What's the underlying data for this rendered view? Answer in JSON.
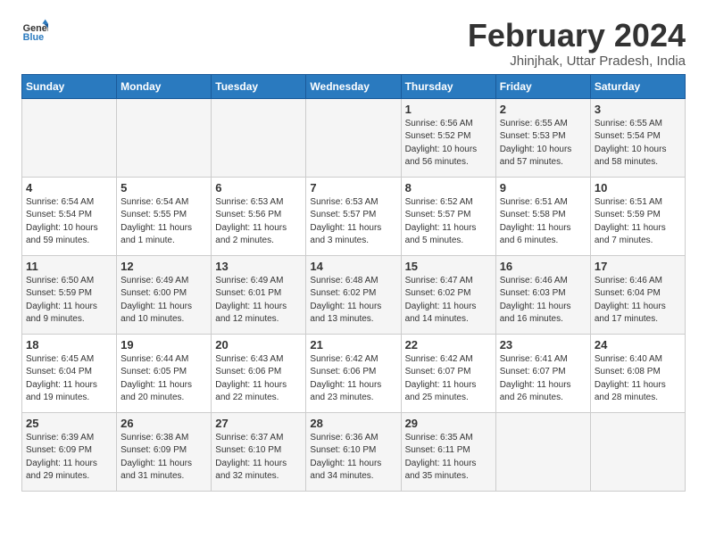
{
  "logo": {
    "line1": "General",
    "line2": "Blue"
  },
  "title": "February 2024",
  "subtitle": "Jhinjhak, Uttar Pradesh, India",
  "header_days": [
    "Sunday",
    "Monday",
    "Tuesday",
    "Wednesday",
    "Thursday",
    "Friday",
    "Saturday"
  ],
  "weeks": [
    [
      {
        "day": "",
        "info": ""
      },
      {
        "day": "",
        "info": ""
      },
      {
        "day": "",
        "info": ""
      },
      {
        "day": "",
        "info": ""
      },
      {
        "day": "1",
        "info": "Sunrise: 6:56 AM\nSunset: 5:52 PM\nDaylight: 10 hours and 56 minutes."
      },
      {
        "day": "2",
        "info": "Sunrise: 6:55 AM\nSunset: 5:53 PM\nDaylight: 10 hours and 57 minutes."
      },
      {
        "day": "3",
        "info": "Sunrise: 6:55 AM\nSunset: 5:54 PM\nDaylight: 10 hours and 58 minutes."
      }
    ],
    [
      {
        "day": "4",
        "info": "Sunrise: 6:54 AM\nSunset: 5:54 PM\nDaylight: 10 hours and 59 minutes."
      },
      {
        "day": "5",
        "info": "Sunrise: 6:54 AM\nSunset: 5:55 PM\nDaylight: 11 hours and 1 minute."
      },
      {
        "day": "6",
        "info": "Sunrise: 6:53 AM\nSunset: 5:56 PM\nDaylight: 11 hours and 2 minutes."
      },
      {
        "day": "7",
        "info": "Sunrise: 6:53 AM\nSunset: 5:57 PM\nDaylight: 11 hours and 3 minutes."
      },
      {
        "day": "8",
        "info": "Sunrise: 6:52 AM\nSunset: 5:57 PM\nDaylight: 11 hours and 5 minutes."
      },
      {
        "day": "9",
        "info": "Sunrise: 6:51 AM\nSunset: 5:58 PM\nDaylight: 11 hours and 6 minutes."
      },
      {
        "day": "10",
        "info": "Sunrise: 6:51 AM\nSunset: 5:59 PM\nDaylight: 11 hours and 7 minutes."
      }
    ],
    [
      {
        "day": "11",
        "info": "Sunrise: 6:50 AM\nSunset: 5:59 PM\nDaylight: 11 hours and 9 minutes."
      },
      {
        "day": "12",
        "info": "Sunrise: 6:49 AM\nSunset: 6:00 PM\nDaylight: 11 hours and 10 minutes."
      },
      {
        "day": "13",
        "info": "Sunrise: 6:49 AM\nSunset: 6:01 PM\nDaylight: 11 hours and 12 minutes."
      },
      {
        "day": "14",
        "info": "Sunrise: 6:48 AM\nSunset: 6:02 PM\nDaylight: 11 hours and 13 minutes."
      },
      {
        "day": "15",
        "info": "Sunrise: 6:47 AM\nSunset: 6:02 PM\nDaylight: 11 hours and 14 minutes."
      },
      {
        "day": "16",
        "info": "Sunrise: 6:46 AM\nSunset: 6:03 PM\nDaylight: 11 hours and 16 minutes."
      },
      {
        "day": "17",
        "info": "Sunrise: 6:46 AM\nSunset: 6:04 PM\nDaylight: 11 hours and 17 minutes."
      }
    ],
    [
      {
        "day": "18",
        "info": "Sunrise: 6:45 AM\nSunset: 6:04 PM\nDaylight: 11 hours and 19 minutes."
      },
      {
        "day": "19",
        "info": "Sunrise: 6:44 AM\nSunset: 6:05 PM\nDaylight: 11 hours and 20 minutes."
      },
      {
        "day": "20",
        "info": "Sunrise: 6:43 AM\nSunset: 6:06 PM\nDaylight: 11 hours and 22 minutes."
      },
      {
        "day": "21",
        "info": "Sunrise: 6:42 AM\nSunset: 6:06 PM\nDaylight: 11 hours and 23 minutes."
      },
      {
        "day": "22",
        "info": "Sunrise: 6:42 AM\nSunset: 6:07 PM\nDaylight: 11 hours and 25 minutes."
      },
      {
        "day": "23",
        "info": "Sunrise: 6:41 AM\nSunset: 6:07 PM\nDaylight: 11 hours and 26 minutes."
      },
      {
        "day": "24",
        "info": "Sunrise: 6:40 AM\nSunset: 6:08 PM\nDaylight: 11 hours and 28 minutes."
      }
    ],
    [
      {
        "day": "25",
        "info": "Sunrise: 6:39 AM\nSunset: 6:09 PM\nDaylight: 11 hours and 29 minutes."
      },
      {
        "day": "26",
        "info": "Sunrise: 6:38 AM\nSunset: 6:09 PM\nDaylight: 11 hours and 31 minutes."
      },
      {
        "day": "27",
        "info": "Sunrise: 6:37 AM\nSunset: 6:10 PM\nDaylight: 11 hours and 32 minutes."
      },
      {
        "day": "28",
        "info": "Sunrise: 6:36 AM\nSunset: 6:10 PM\nDaylight: 11 hours and 34 minutes."
      },
      {
        "day": "29",
        "info": "Sunrise: 6:35 AM\nSunset: 6:11 PM\nDaylight: 11 hours and 35 minutes."
      },
      {
        "day": "",
        "info": ""
      },
      {
        "day": "",
        "info": ""
      }
    ]
  ]
}
